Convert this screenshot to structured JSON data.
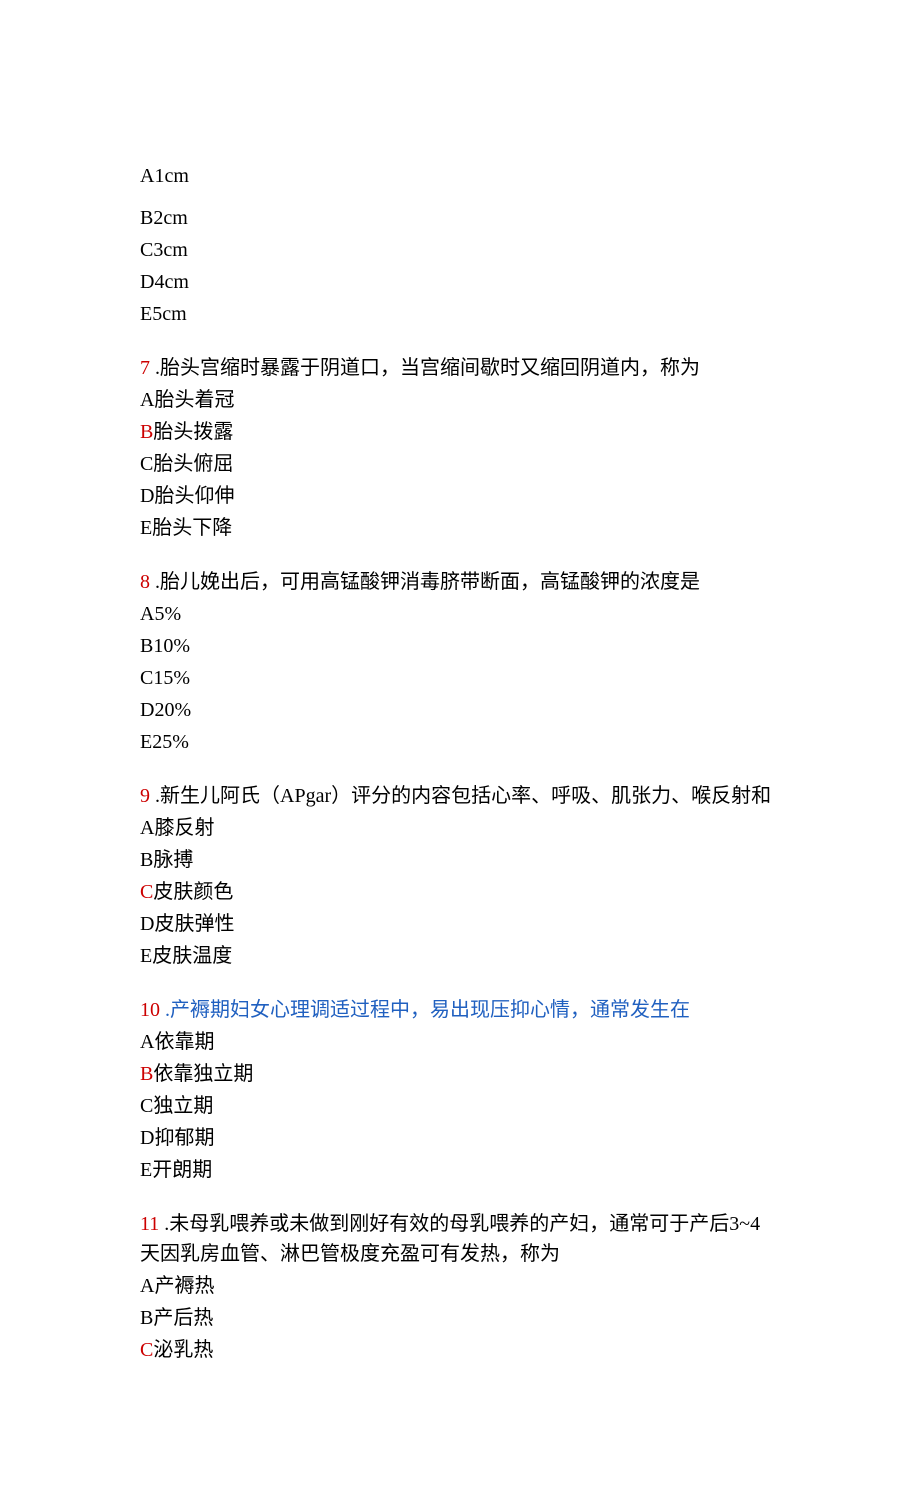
{
  "lead": {
    "a": "A1cm",
    "b": "B2cm",
    "c": "C3cm",
    "d": "D4cm",
    "e": "E5cm"
  },
  "q7": {
    "num": "7",
    "stem": " .胎头宫缩时暴露于阴道口，当宫缩间歇时又缩回阴道内，称为",
    "a": "A胎头着冠",
    "b_key": "B",
    "b_rest": "胎头拨露",
    "c": "C胎头俯屈",
    "d": "D胎头仰伸",
    "e": "E胎头下降"
  },
  "q8": {
    "num": "8",
    "stem": " .胎儿娩出后，可用高锰酸钾消毒脐带断面，高锰酸钾的浓度是",
    "a": "A5%",
    "b": "B10%",
    "c": "C15%",
    "d": "D20%",
    "e": "E25%"
  },
  "q9": {
    "num": "9",
    "stem": " .新生儿阿氏（APgar）评分的内容包括心率、呼吸、肌张力、喉反射和",
    "a": "A膝反射",
    "b": "B脉搏",
    "c_key": "C",
    "c_rest": "皮肤颜色",
    "d": "D皮肤弹性",
    "e": "E皮肤温度"
  },
  "q10": {
    "num": "10",
    "stem": " .产褥期妇女心理调适过程中，易出现压抑心情，通常发生在",
    "a": "A依靠期",
    "b_key": "B",
    "b_rest": "依靠独立期",
    "c": "C独立期",
    "d": "D抑郁期",
    "e": "E开朗期"
  },
  "q11": {
    "num": "11",
    "stem1": " .未母乳喂养或未做到刚好有效的母乳喂养的产妇，通常可于产后3~4天因乳房血管、淋巴管极度充盈可有发热，称为",
    "a": "A产褥热",
    "b": "B产后热",
    "c_key": "C",
    "c_rest": "泌乳热"
  }
}
